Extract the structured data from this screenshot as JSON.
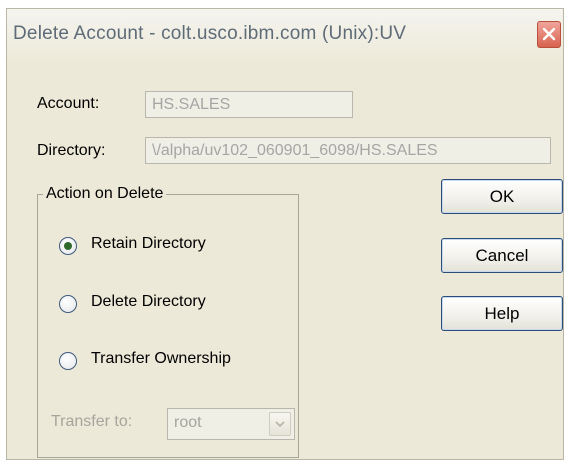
{
  "window": {
    "title": "Delete Account - colt.usco.ibm.com (Unix):UV"
  },
  "fields": {
    "account_label": "Account:",
    "account_value": "HS.SALES",
    "directory_label": "Directory:",
    "directory_value": "\\/alpha/uv102_060901_6098/HS.SALES"
  },
  "action_group": {
    "legend": "Action on Delete",
    "options": [
      {
        "label": "Retain Directory",
        "selected": true
      },
      {
        "label": "Delete Directory",
        "selected": false
      },
      {
        "label": "Transfer Ownership",
        "selected": false
      }
    ],
    "transfer_label": "Transfer to:",
    "transfer_value": "root"
  },
  "buttons": {
    "ok": "OK",
    "cancel": "Cancel",
    "help": "Help"
  }
}
